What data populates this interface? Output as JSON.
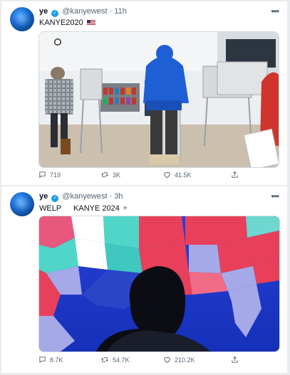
{
  "tweets": [
    {
      "name": "ye",
      "handle": "@kanyewest",
      "separator": "·",
      "time": "11h",
      "text": "KANYE2020",
      "replies": "719",
      "retweets": "3K",
      "likes": "41.5K"
    },
    {
      "name": "ye",
      "handle": "@kanyewest",
      "separator": "·",
      "time": "3h",
      "text": "WELP",
      "text2": "KANYE 2024",
      "replies": "8.7K",
      "retweets": "54.7K",
      "likes": "210.2K"
    }
  ],
  "icons": {
    "verified": "verified-badge-icon",
    "more": "more-options-icon",
    "reply": "reply-icon",
    "retweet": "retweet-icon",
    "like": "heart-icon",
    "share": "share-icon",
    "flag": "us-flag-emoji",
    "sparkle": "sparkle-emoji"
  },
  "colors": {
    "verified": "#1d9bf0",
    "muted_text": "#536471",
    "background": "#e9ebee"
  }
}
